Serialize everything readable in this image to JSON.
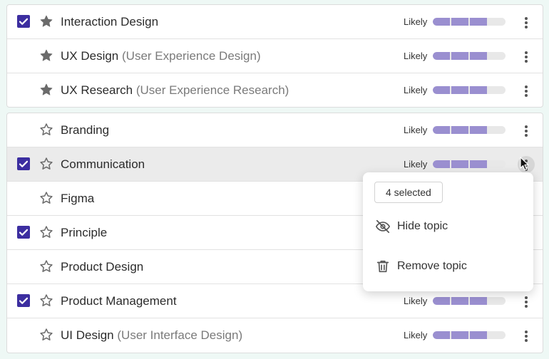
{
  "strength_label": "Likely",
  "groups": [
    {
      "rows": [
        {
          "checked": true,
          "starred": true,
          "name": "Interaction Design",
          "alt": "",
          "filled": 3
        },
        {
          "checked": false,
          "starred": true,
          "name": "UX Design",
          "alt": "(User Experience Design)",
          "filled": 3
        },
        {
          "checked": false,
          "starred": true,
          "name": "UX Research",
          "alt": "(User Experience Research)",
          "filled": 3
        }
      ]
    },
    {
      "rows": [
        {
          "checked": false,
          "starred": false,
          "name": "Branding",
          "alt": "",
          "filled": 3,
          "show_strength": true
        },
        {
          "checked": true,
          "starred": false,
          "name": "Communication",
          "alt": "",
          "filled": 3,
          "show_strength": true,
          "hover": true
        },
        {
          "checked": false,
          "starred": false,
          "name": "Figma",
          "alt": "",
          "filled": 3,
          "show_strength": false
        },
        {
          "checked": true,
          "starred": false,
          "name": "Principle",
          "alt": "",
          "filled": 3,
          "show_strength": false
        },
        {
          "checked": false,
          "starred": false,
          "name": "Product Design",
          "alt": "",
          "filled": 3,
          "show_strength": false
        },
        {
          "checked": true,
          "starred": false,
          "name": "Product Management",
          "alt": "",
          "filled": 3,
          "show_strength": true
        },
        {
          "checked": false,
          "starred": false,
          "name": "UI Design",
          "alt": "(User Interface Design)",
          "filled": 3,
          "show_strength": true
        }
      ]
    }
  ],
  "strength_max": 4,
  "context_menu": {
    "selected_badge": "4 selected",
    "items": [
      {
        "label": "Hide topic",
        "icon": "eye-off-icon"
      },
      {
        "label": "Remove topic",
        "icon": "trash-icon"
      }
    ]
  },
  "colors": {
    "accent": "#3c2ea0",
    "meter_fill": "#9a8fd0",
    "meter_track": "#e8e8e8"
  }
}
